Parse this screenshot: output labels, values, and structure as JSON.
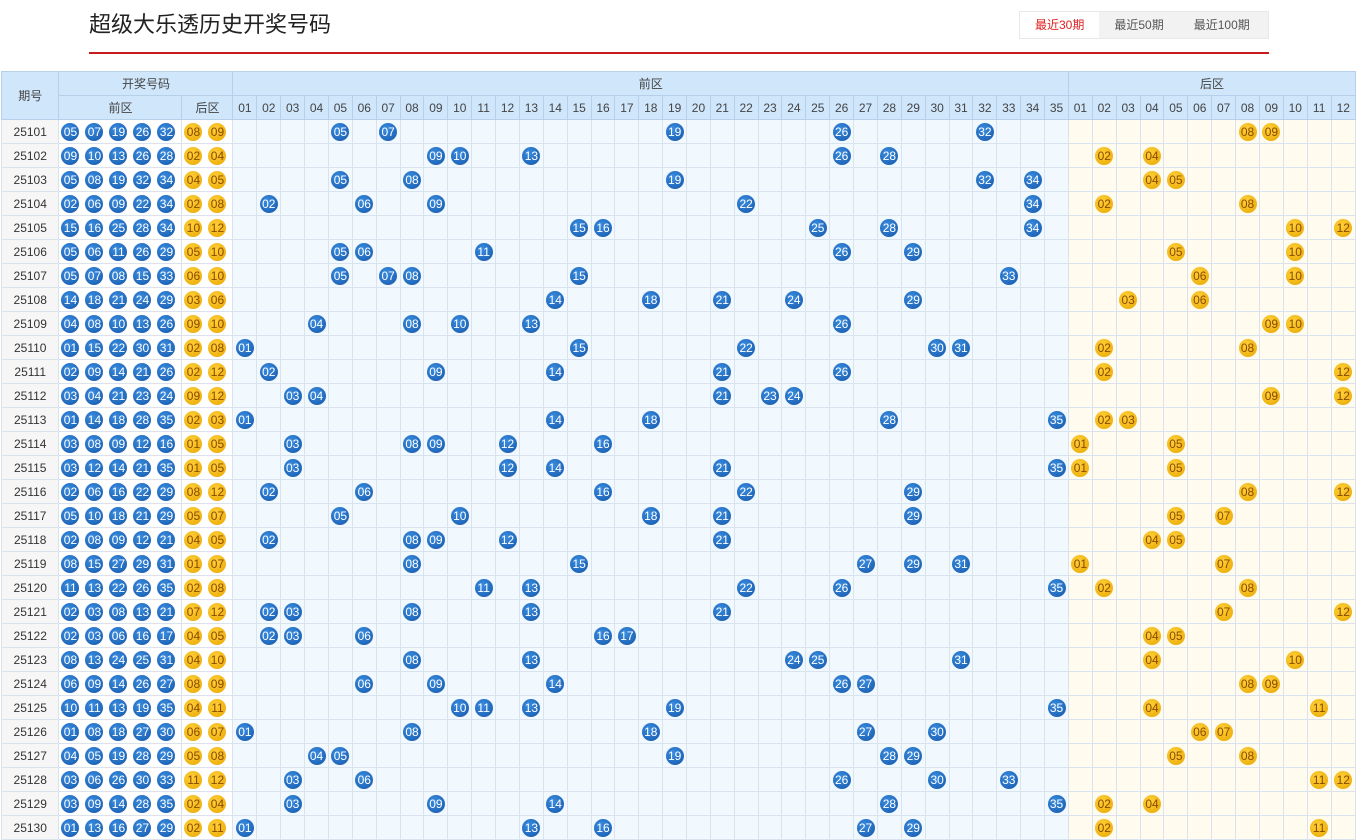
{
  "page_title": "超级大乐透历史开奖号码",
  "tabs": [
    {
      "label": "最近30期",
      "active": true
    },
    {
      "label": "最近50期",
      "active": false
    },
    {
      "label": "最近100期",
      "active": false
    }
  ],
  "table": {
    "header": {
      "issue": "期号",
      "winning": "开奖号码",
      "front_zone": "前区",
      "back_zone": "后区",
      "front_sub": "前区",
      "back_sub": "后区"
    },
    "front_numbers": [
      "01",
      "02",
      "03",
      "04",
      "05",
      "06",
      "07",
      "08",
      "09",
      "10",
      "11",
      "12",
      "13",
      "14",
      "15",
      "16",
      "17",
      "18",
      "19",
      "20",
      "21",
      "22",
      "23",
      "24",
      "25",
      "26",
      "27",
      "28",
      "29",
      "30",
      "31",
      "32",
      "33",
      "34",
      "35"
    ],
    "back_numbers": [
      "01",
      "02",
      "03",
      "04",
      "05",
      "06",
      "07",
      "08",
      "09",
      "10",
      "11",
      "12"
    ],
    "rows": [
      {
        "issue": "25101",
        "front": [
          "05",
          "07",
          "19",
          "26",
          "32"
        ],
        "back": [
          "08",
          "09"
        ]
      },
      {
        "issue": "25102",
        "front": [
          "09",
          "10",
          "13",
          "26",
          "28"
        ],
        "back": [
          "02",
          "04"
        ]
      },
      {
        "issue": "25103",
        "front": [
          "05",
          "08",
          "19",
          "32",
          "34"
        ],
        "back": [
          "04",
          "05"
        ]
      },
      {
        "issue": "25104",
        "front": [
          "02",
          "06",
          "09",
          "22",
          "34"
        ],
        "back": [
          "02",
          "08"
        ]
      },
      {
        "issue": "25105",
        "front": [
          "15",
          "16",
          "25",
          "28",
          "34"
        ],
        "back": [
          "10",
          "12"
        ]
      },
      {
        "issue": "25106",
        "front": [
          "05",
          "06",
          "11",
          "26",
          "29"
        ],
        "back": [
          "05",
          "10"
        ]
      },
      {
        "issue": "25107",
        "front": [
          "05",
          "07",
          "08",
          "15",
          "33"
        ],
        "back": [
          "06",
          "10"
        ]
      },
      {
        "issue": "25108",
        "front": [
          "14",
          "18",
          "21",
          "24",
          "29"
        ],
        "back": [
          "03",
          "06"
        ]
      },
      {
        "issue": "25109",
        "front": [
          "04",
          "08",
          "10",
          "13",
          "26"
        ],
        "back": [
          "09",
          "10"
        ]
      },
      {
        "issue": "25110",
        "front": [
          "01",
          "15",
          "22",
          "30",
          "31"
        ],
        "back": [
          "02",
          "08"
        ]
      },
      {
        "issue": "25111",
        "front": [
          "02",
          "09",
          "14",
          "21",
          "26"
        ],
        "back": [
          "02",
          "12"
        ]
      },
      {
        "issue": "25112",
        "front": [
          "03",
          "04",
          "21",
          "23",
          "24"
        ],
        "back": [
          "09",
          "12"
        ]
      },
      {
        "issue": "25113",
        "front": [
          "01",
          "14",
          "18",
          "28",
          "35"
        ],
        "back": [
          "02",
          "03"
        ]
      },
      {
        "issue": "25114",
        "front": [
          "03",
          "08",
          "09",
          "12",
          "16"
        ],
        "back": [
          "01",
          "05"
        ]
      },
      {
        "issue": "25115",
        "front": [
          "03",
          "12",
          "14",
          "21",
          "35"
        ],
        "back": [
          "01",
          "05"
        ]
      },
      {
        "issue": "25116",
        "front": [
          "02",
          "06",
          "16",
          "22",
          "29"
        ],
        "back": [
          "08",
          "12"
        ]
      },
      {
        "issue": "25117",
        "front": [
          "05",
          "10",
          "18",
          "21",
          "29"
        ],
        "back": [
          "05",
          "07"
        ]
      },
      {
        "issue": "25118",
        "front": [
          "02",
          "08",
          "09",
          "12",
          "21"
        ],
        "back": [
          "04",
          "05"
        ]
      },
      {
        "issue": "25119",
        "front": [
          "08",
          "15",
          "27",
          "29",
          "31"
        ],
        "back": [
          "01",
          "07"
        ]
      },
      {
        "issue": "25120",
        "front": [
          "11",
          "13",
          "22",
          "26",
          "35"
        ],
        "back": [
          "02",
          "08"
        ]
      },
      {
        "issue": "25121",
        "front": [
          "02",
          "03",
          "08",
          "13",
          "21"
        ],
        "back": [
          "07",
          "12"
        ]
      },
      {
        "issue": "25122",
        "front": [
          "02",
          "03",
          "06",
          "16",
          "17"
        ],
        "back": [
          "04",
          "05"
        ]
      },
      {
        "issue": "25123",
        "front": [
          "08",
          "13",
          "24",
          "25",
          "31"
        ],
        "back": [
          "04",
          "10"
        ]
      },
      {
        "issue": "25124",
        "front": [
          "06",
          "09",
          "14",
          "26",
          "27"
        ],
        "back": [
          "08",
          "09"
        ]
      },
      {
        "issue": "25125",
        "front": [
          "10",
          "11",
          "13",
          "19",
          "35"
        ],
        "back": [
          "04",
          "11"
        ]
      },
      {
        "issue": "25126",
        "front": [
          "01",
          "08",
          "18",
          "27",
          "30"
        ],
        "back": [
          "06",
          "07"
        ]
      },
      {
        "issue": "25127",
        "front": [
          "04",
          "05",
          "19",
          "28",
          "29"
        ],
        "back": [
          "05",
          "08"
        ]
      },
      {
        "issue": "25128",
        "front": [
          "03",
          "06",
          "26",
          "30",
          "33"
        ],
        "back": [
          "11",
          "12"
        ]
      },
      {
        "issue": "25129",
        "front": [
          "03",
          "09",
          "14",
          "28",
          "35"
        ],
        "back": [
          "02",
          "04"
        ]
      },
      {
        "issue": "25130",
        "front": [
          "01",
          "13",
          "16",
          "27",
          "29"
        ],
        "back": [
          "02",
          "11"
        ]
      }
    ]
  },
  "colors": {
    "front_ball": "#1e6bc1",
    "back_ball": "#f3b500",
    "accent_red": "#c81c1c",
    "header_bg": "#cfe6fb"
  }
}
